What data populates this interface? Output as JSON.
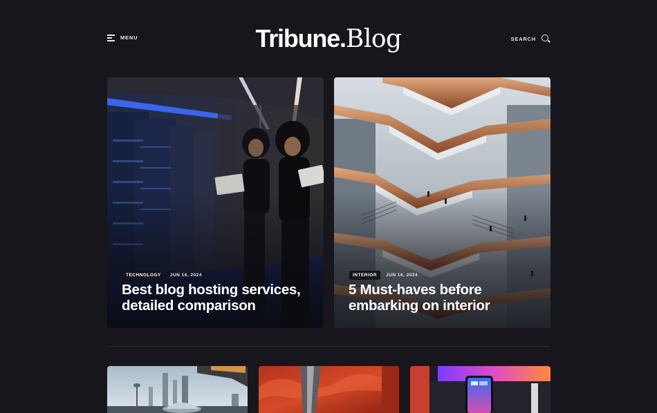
{
  "header": {
    "menu_label": "MENU",
    "logo_part1": "Tribune.",
    "logo_part2": "Blog",
    "search_label": "SEARCH"
  },
  "featured": [
    {
      "tag": "TECHNOLOGY",
      "date": "JUN 16, 2024",
      "title": "Best blog hosting services, detailed comparison",
      "image": "server-room-woman-with-tablet"
    },
    {
      "tag": "INTERIOR",
      "date": "JUN 16, 2024",
      "title": "5 Must-haves before embarking on interior",
      "image": "copper-honeycomb-staircase-structure"
    }
  ],
  "thumbnails": [
    {
      "image": "city-skyline-with-sports-car"
    },
    {
      "image": "red-fabric-close-up"
    },
    {
      "image": "smartphone-on-desk-with-monitor"
    }
  ],
  "colors": {
    "background": "#17161c",
    "text": "#ffffff",
    "tag_background": "#15141a",
    "divider": "#2c2b33"
  }
}
